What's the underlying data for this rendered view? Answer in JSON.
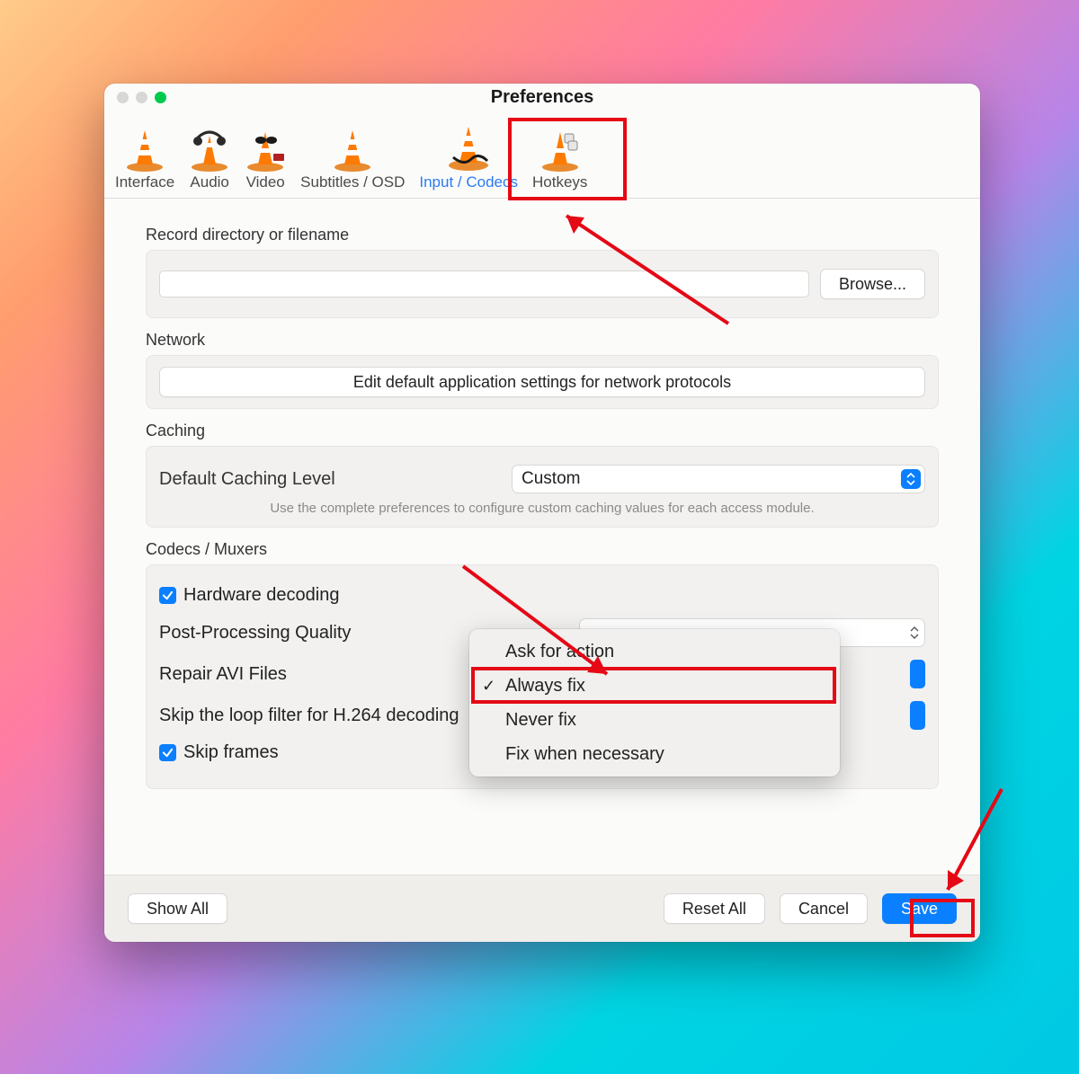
{
  "window": {
    "title": "Preferences"
  },
  "tabs": [
    {
      "label": "Interface"
    },
    {
      "label": "Audio"
    },
    {
      "label": "Video"
    },
    {
      "label": "Subtitles / OSD"
    },
    {
      "label": "Input / Codecs"
    },
    {
      "label": "Hotkeys"
    }
  ],
  "sections": {
    "record_label": "Record directory or filename",
    "record_value": "",
    "browse": "Browse...",
    "network_label": "Network",
    "network_button": "Edit default application settings for network protocols",
    "caching_label": "Caching",
    "caching_level_label": "Default Caching Level",
    "caching_level_value": "Custom",
    "caching_hint": "Use the complete preferences to configure custom caching values for each access module.",
    "codecs_label": "Codecs / Muxers",
    "hw_decoding": "Hardware decoding",
    "postproc": "Post-Processing Quality",
    "repair_avi": "Repair AVI Files",
    "skip_loop": "Skip the loop filter for H.264 decoding",
    "skip_frames": "Skip frames"
  },
  "dropdown": {
    "items": [
      "Ask for action",
      "Always fix",
      "Never fix",
      "Fix when necessary"
    ],
    "selected_index": 1
  },
  "buttons": {
    "show_all": "Show All",
    "reset_all": "Reset All",
    "cancel": "Cancel",
    "save": "Save"
  }
}
